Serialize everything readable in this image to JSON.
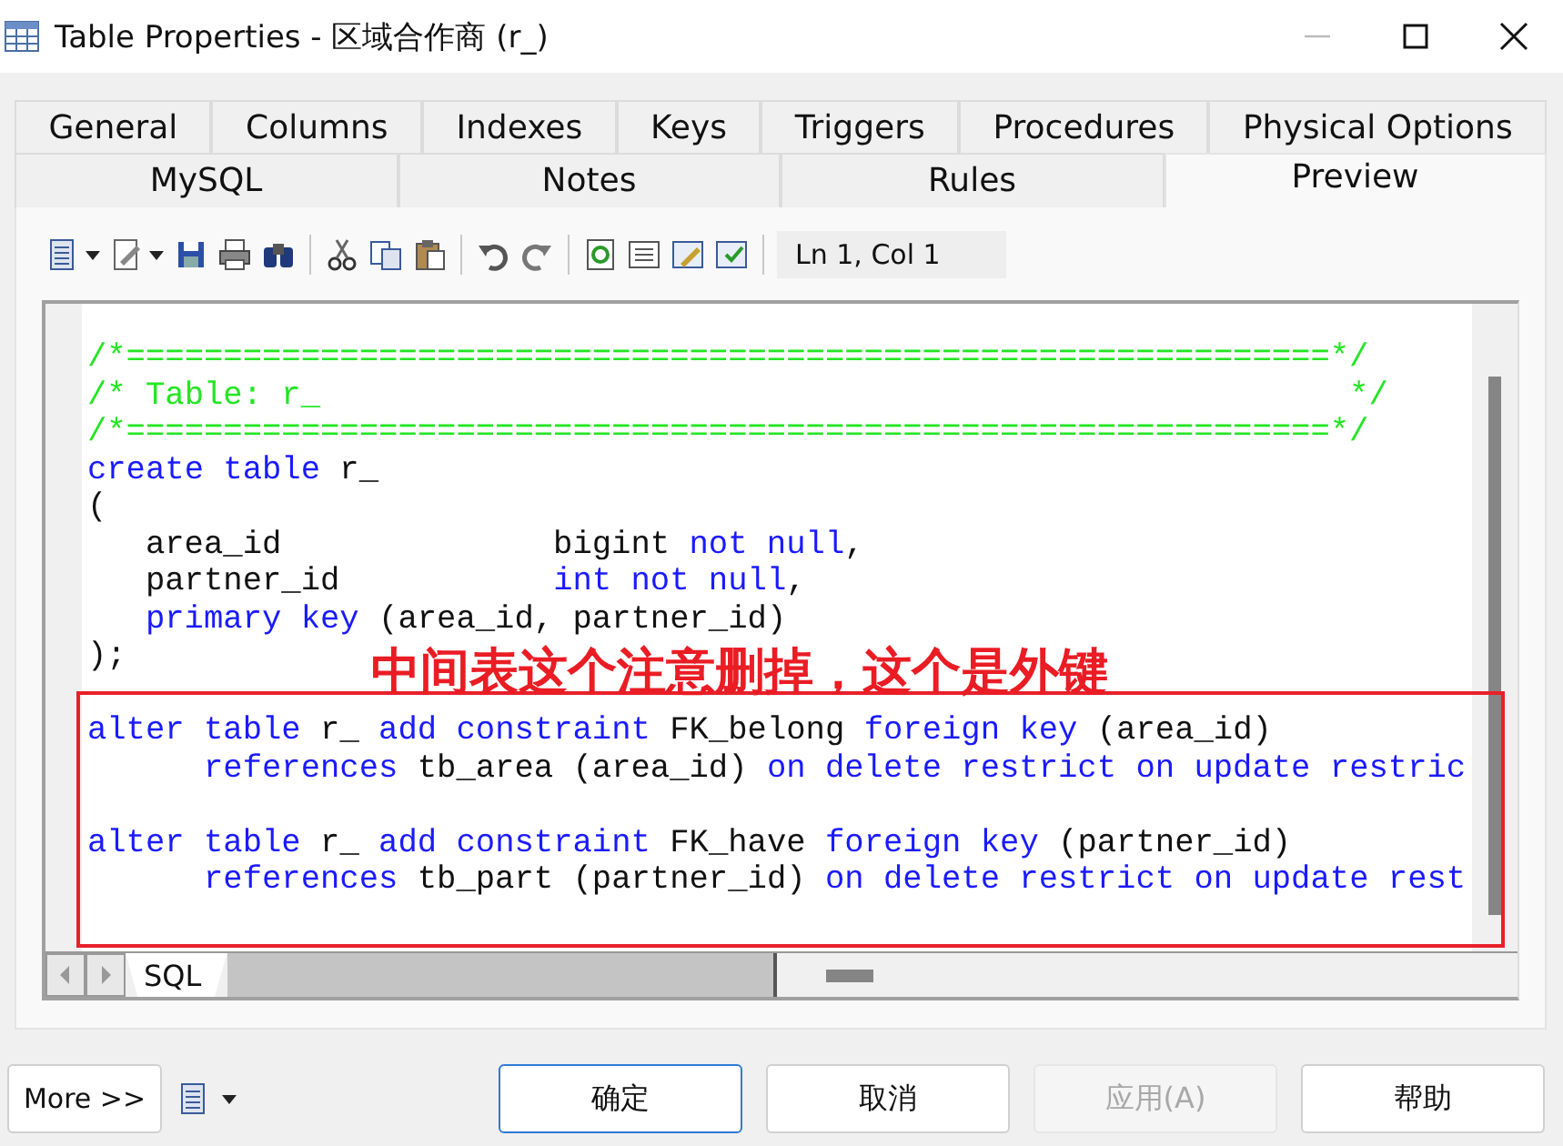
{
  "window": {
    "title": "Table Properties - 区域合作商 (r_)"
  },
  "tab_rows": [
    [
      {
        "label": "General",
        "selected": false
      },
      {
        "label": "Columns",
        "selected": false
      },
      {
        "label": "Indexes",
        "selected": false
      },
      {
        "label": "Keys",
        "selected": false
      },
      {
        "label": "Triggers",
        "selected": false
      },
      {
        "label": "Procedures",
        "selected": false
      },
      {
        "label": "Physical Options",
        "selected": false
      }
    ],
    [
      {
        "label": "MySQL",
        "selected": false
      },
      {
        "label": "Notes",
        "selected": false
      },
      {
        "label": "Rules",
        "selected": false
      },
      {
        "label": "Preview",
        "selected": true
      }
    ]
  ],
  "toolbar": {
    "position": "Ln 1, Col 1"
  },
  "editor": {
    "blocks": [
      {
        "highlighted": false,
        "lines": [
          {
            "kind": "statement",
            "segments": [
              {
                "text": "/*==============================================================*/",
                "kind": "comment"
              }
            ]
          },
          {
            "kind": "statement",
            "segments": [
              {
                "text": "/* Table: r_                                                     */",
                "kind": "comment"
              }
            ]
          },
          {
            "kind": "statement",
            "segments": [
              {
                "text": "/*==============================================================*/",
                "kind": "comment"
              }
            ]
          },
          {
            "kind": "statement",
            "segments": [
              {
                "text": "create table",
                "kind": "keyword"
              },
              {
                "text": " r_",
                "kind": "plain"
              }
            ]
          },
          {
            "kind": "statement",
            "segments": [
              {
                "text": "(",
                "kind": "plain"
              }
            ]
          },
          {
            "kind": "column",
            "segments": [
              {
                "text": "area_id              bigint ",
                "kind": "plain"
              },
              {
                "text": "not null",
                "kind": "keyword"
              },
              {
                "text": ",",
                "kind": "plain"
              }
            ]
          },
          {
            "kind": "column",
            "segments": [
              {
                "text": "partner_id           ",
                "kind": "plain"
              },
              {
                "text": "int not null",
                "kind": "keyword"
              },
              {
                "text": ",",
                "kind": "plain"
              }
            ]
          },
          {
            "kind": "column",
            "segments": [
              {
                "text": "primary key",
                "kind": "keyword"
              },
              {
                "text": " (area_id, partner_id)",
                "kind": "plain"
              }
            ]
          },
          {
            "kind": "statement",
            "segments": [
              {
                "text": ");",
                "kind": "plain"
              }
            ]
          }
        ]
      },
      {
        "highlighted": true,
        "lines": [
          {
            "kind": "statement",
            "segments": [
              {
                "text": "alter table",
                "kind": "keyword"
              },
              {
                "text": " r_ ",
                "kind": "plain"
              },
              {
                "text": "add constraint",
                "kind": "keyword"
              },
              {
                "text": " FK_belong ",
                "kind": "plain"
              },
              {
                "text": "foreign key",
                "kind": "keyword"
              },
              {
                "text": " (area_id)",
                "kind": "plain"
              }
            ]
          },
          {
            "kind": "continuation",
            "segments": [
              {
                "text": "references",
                "kind": "keyword"
              },
              {
                "text": " tb_area (area_id) ",
                "kind": "plain"
              },
              {
                "text": "on delete restrict on update restric",
                "kind": "keyword"
              }
            ]
          }
        ]
      },
      {
        "highlighted": true,
        "lines": [
          {
            "kind": "statement",
            "segments": [
              {
                "text": "alter table",
                "kind": "keyword"
              },
              {
                "text": " r_ ",
                "kind": "plain"
              },
              {
                "text": "add constraint",
                "kind": "keyword"
              },
              {
                "text": " FK_have ",
                "kind": "plain"
              },
              {
                "text": "foreign key",
                "kind": "keyword"
              },
              {
                "text": " (partner_id)",
                "kind": "plain"
              }
            ]
          },
          {
            "kind": "continuation",
            "segments": [
              {
                "text": "references",
                "kind": "keyword"
              },
              {
                "text": " tb_part (partner_id) ",
                "kind": "plain"
              },
              {
                "text": "on delete restrict on update rest",
                "kind": "keyword"
              }
            ]
          }
        ]
      }
    ],
    "annotation": "中间表这个注意删掉，这个是外键",
    "sheet_tab": "SQL"
  },
  "more_button": "More >>",
  "buttons": [
    {
      "label": "确定",
      "default": true,
      "disabled": false
    },
    {
      "label": "取消",
      "default": false,
      "disabled": false
    },
    {
      "label": "应用(A)",
      "default": false,
      "disabled": true
    },
    {
      "label": "帮助",
      "default": false,
      "disabled": false
    }
  ]
}
